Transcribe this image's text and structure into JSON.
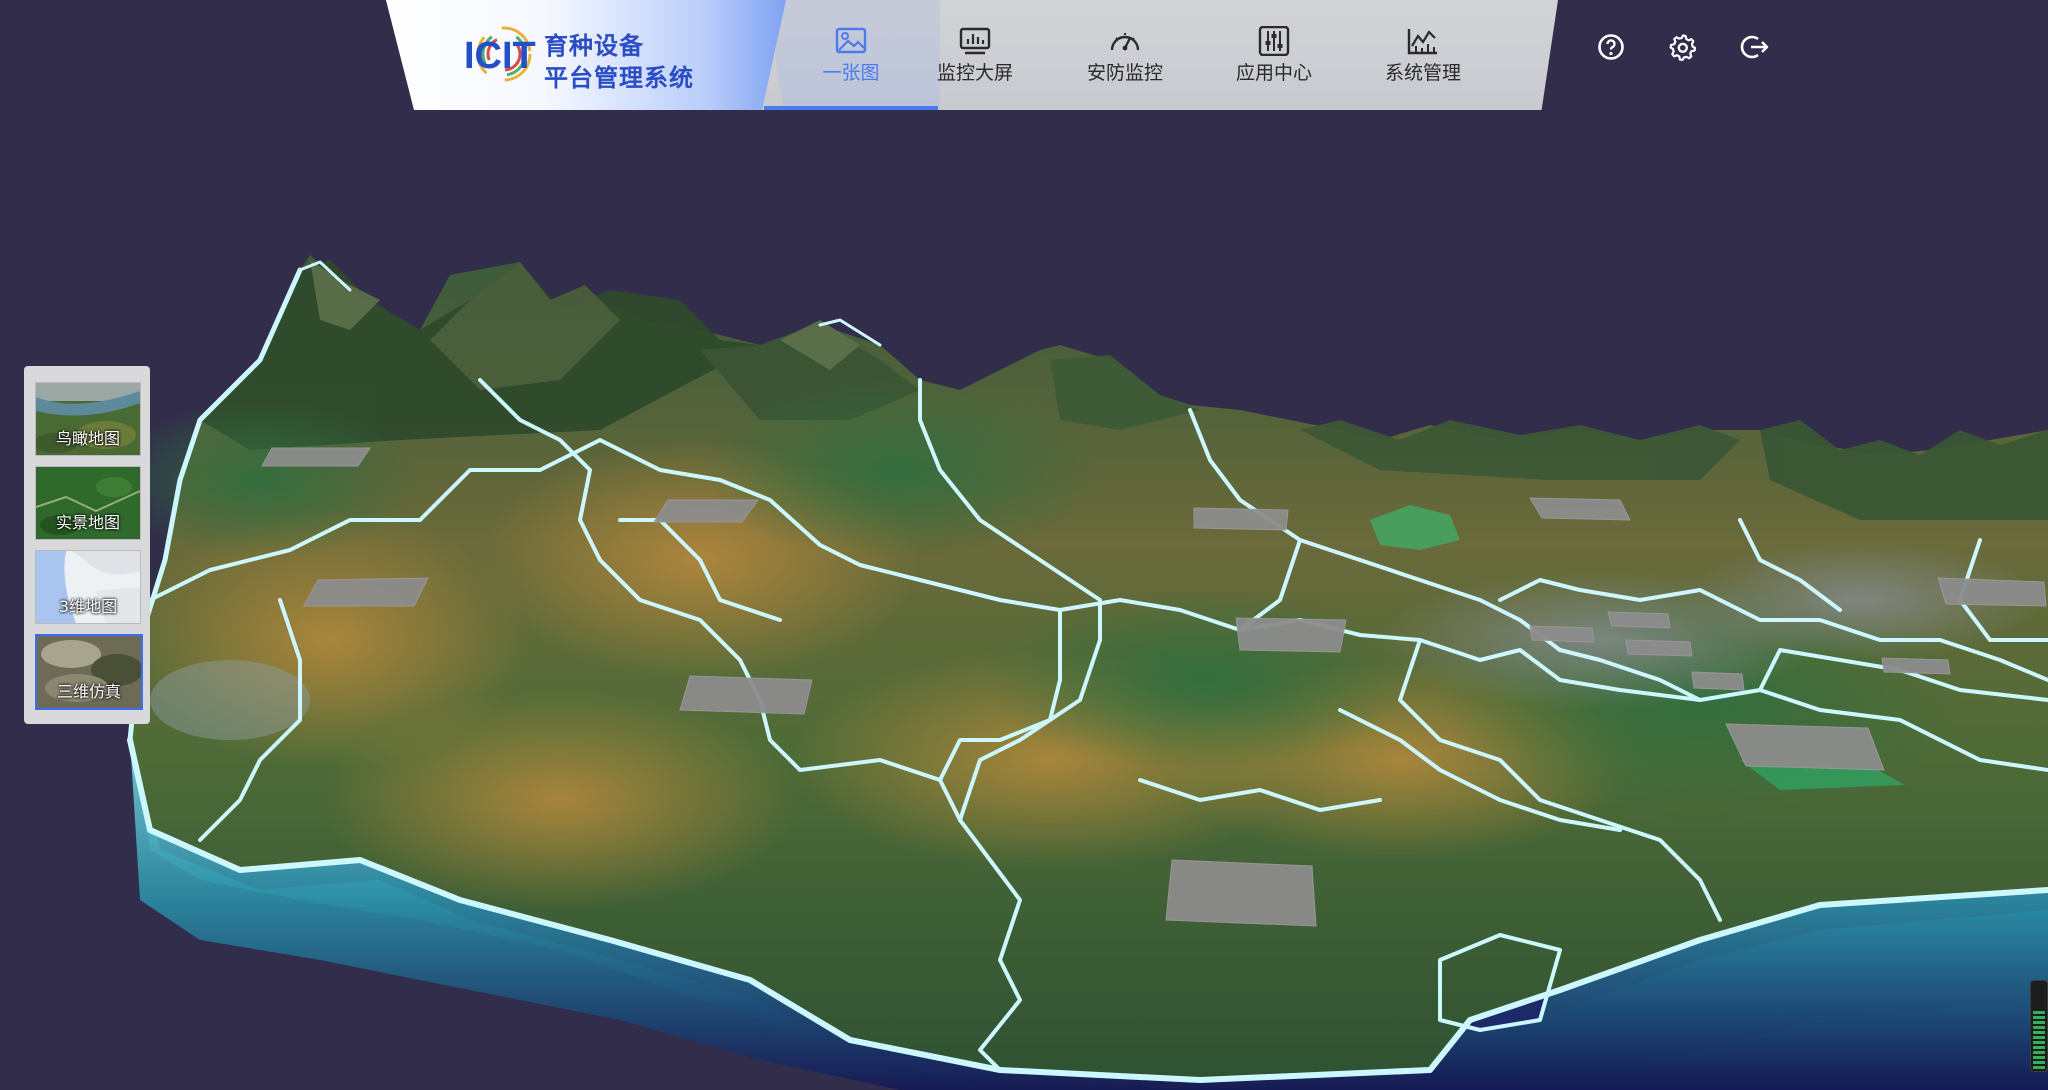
{
  "app": {
    "logo_letters": "ICIT",
    "title_line1": "育种设备",
    "title_line2": "平台管理系统"
  },
  "nav": {
    "items": [
      {
        "label": "一张图",
        "icon": "image-icon",
        "active": true
      },
      {
        "label": "监控大屏",
        "icon": "monitor-chart-icon",
        "active": false
      },
      {
        "label": "安防监控",
        "icon": "gauge-icon",
        "active": false
      },
      {
        "label": "应用中心",
        "icon": "sliders-icon",
        "active": false
      },
      {
        "label": "系统管理",
        "icon": "line-chart-icon",
        "active": false
      }
    ]
  },
  "header_actions": [
    {
      "name": "help",
      "icon": "help-circle-icon"
    },
    {
      "name": "settings",
      "icon": "gear-icon"
    },
    {
      "name": "logout",
      "icon": "logout-icon"
    }
  ],
  "map_switcher": {
    "items": [
      {
        "label": "鸟瞰地图",
        "active": false
      },
      {
        "label": "实景地图",
        "active": false
      },
      {
        "label": "3维地图",
        "active": false
      },
      {
        "label": "三维仿真",
        "active": true
      }
    ]
  },
  "colors": {
    "background": "#312d4a",
    "accent": "#4c7bf0",
    "boundary": "#c9f6ff",
    "terrain_edge": "#3aa5b6"
  }
}
